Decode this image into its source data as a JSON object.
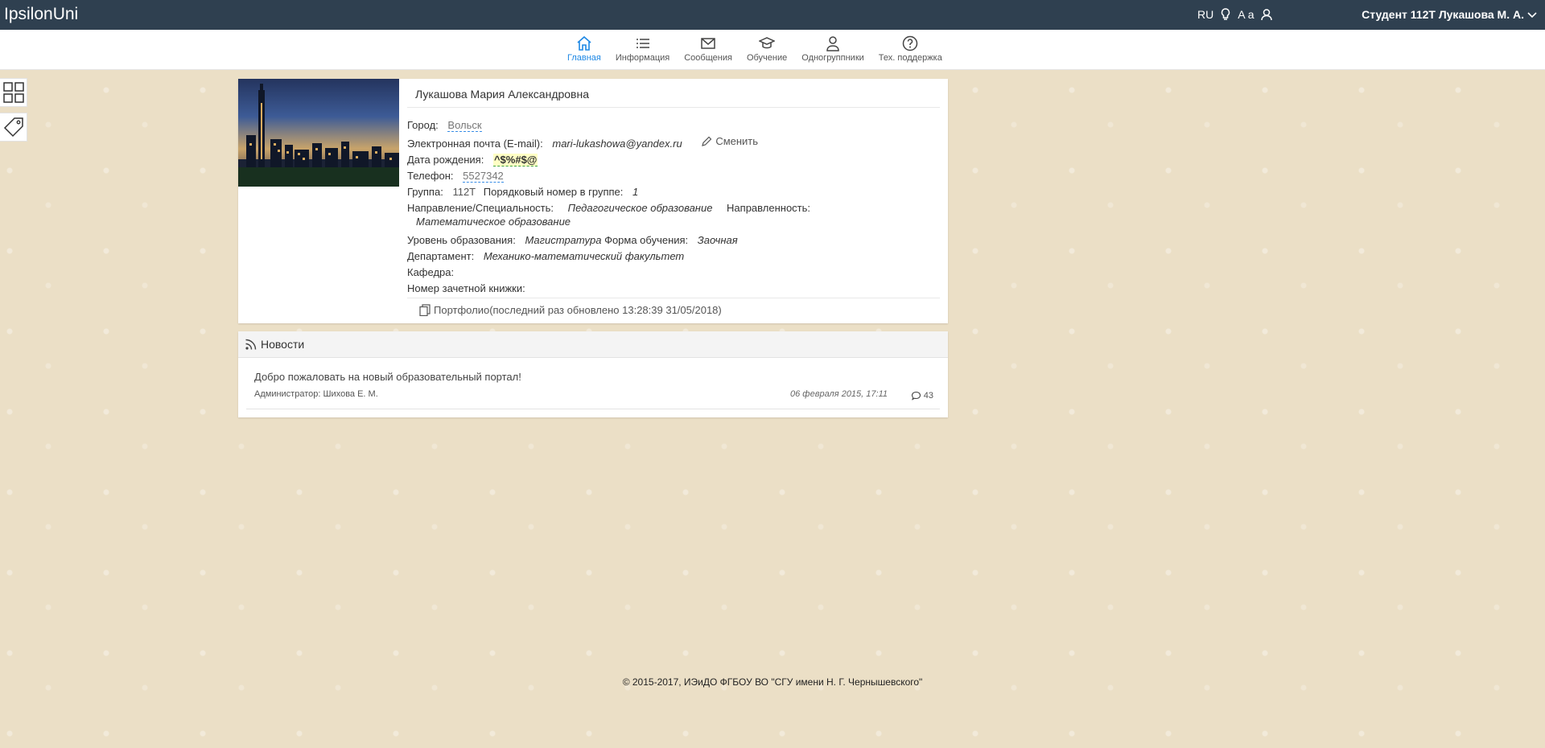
{
  "app": {
    "brand": "IpsilonUni"
  },
  "topbar": {
    "lang": "RU",
    "font_toggle": "A a",
    "user_label": "Студент 112Т Лукашова М. А."
  },
  "nav": {
    "items": [
      {
        "label": "Главная",
        "icon": "home-icon",
        "active": true
      },
      {
        "label": "Информация",
        "icon": "list-icon"
      },
      {
        "label": "Сообщения",
        "icon": "envelope-icon"
      },
      {
        "label": "Обучение",
        "icon": "graduation-cap-icon"
      },
      {
        "label": "Одногруппники",
        "icon": "users-icon"
      },
      {
        "label": "Тех. поддержка",
        "icon": "help-icon"
      }
    ]
  },
  "profile": {
    "full_name": "Лукашова Мария Александровна",
    "city_label": "Город:",
    "city": "Вольск",
    "email_label": "Электронная почта (E-mail):",
    "email": "mari-lukashowa@yandex.ru",
    "change_label": "Сменить",
    "birth_label": "Дата рождения:",
    "birth": "^$%#$@",
    "phone_label": "Телефон:",
    "phone": "5527342",
    "group_label": "Группа:",
    "group": "112Т",
    "order_label": "Порядковый номер в группе:",
    "order": "1",
    "direction_label": "Направление/Специальность:",
    "direction": "Педагогическое образование",
    "focus_label": "Направленность:",
    "focus": "Математическое образование",
    "level_label": "Уровень образования:",
    "level": "Магистратура",
    "form_label": "Форма обучения:",
    "form": "Заочная",
    "dept_label": "Департамент:",
    "dept": "Механико-математический факультет",
    "chair_label": "Кафедра:",
    "record_label": "Номер зачетной книжки:",
    "portfolio": "Портфолио(последний раз обновлено 13:28:39 31/05/2018)"
  },
  "news": {
    "header": "Новости",
    "items": [
      {
        "title": "Добро пожаловать на новый образовательный портал!",
        "author": "Администратор: Шихова Е. М.",
        "date": "06 февраля 2015, 17:11",
        "comments": "43"
      }
    ]
  },
  "footer": "© 2015-2017, ИЭиДО ФГБОУ ВО \"СГУ имени Н. Г. Чернышевского\""
}
